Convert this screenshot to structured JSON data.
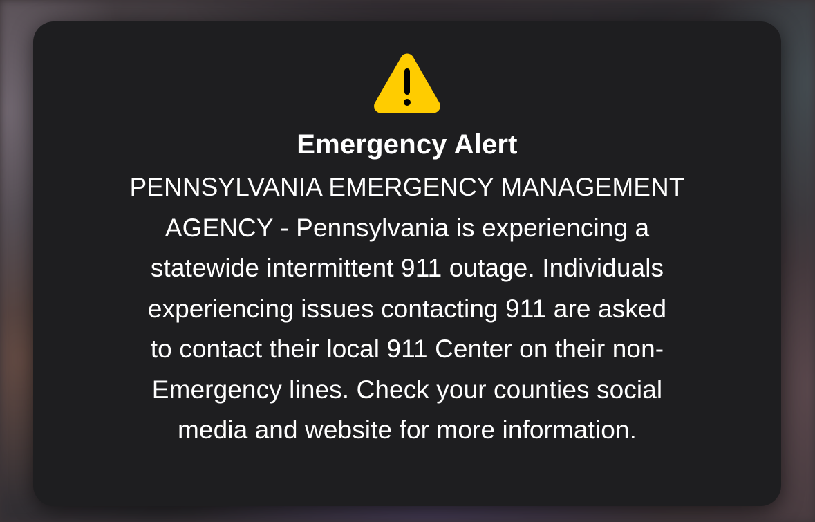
{
  "alert": {
    "icon": "warning-triangle-icon",
    "icon_color": "#FFCC00",
    "title": "Emergency Alert",
    "body": "PENNSYLVANIA EMERGENCY MANAGEMENT\nAGENCY - Pennsylvania is experiencing a\nstatewide intermittent 911 outage.  Individuals\nexperiencing issues contacting 911 are asked\nto contact their local 911 Center on their non-\nEmergency lines.  Check your counties social\nmedia and website for more information."
  }
}
